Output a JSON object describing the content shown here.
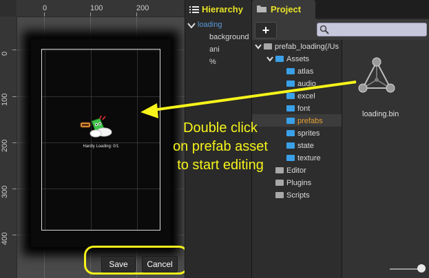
{
  "ruler": {
    "top_labels": [
      "0",
      "100",
      "200"
    ],
    "left_labels": [
      "0",
      "100",
      "200",
      "300",
      "400"
    ]
  },
  "scene": {
    "loading_text": "Hardly Loading: 0/1",
    "save_label": "Save",
    "cancel_label": "Cancel"
  },
  "hierarchy": {
    "title": "Hierarchy",
    "items": [
      {
        "label": "loading"
      },
      {
        "label": "background"
      },
      {
        "label": "ani"
      },
      {
        "label": "%"
      }
    ]
  },
  "project": {
    "title": "Project",
    "add_label": "+",
    "tree": [
      {
        "label": "prefab_loading(/Us"
      },
      {
        "label": "Assets"
      },
      {
        "label": "atlas"
      },
      {
        "label": "audio"
      },
      {
        "label": "excel"
      },
      {
        "label": "font"
      },
      {
        "label": "prefabs"
      },
      {
        "label": "sprites"
      },
      {
        "label": "state"
      },
      {
        "label": "texture"
      },
      {
        "label": "Editor"
      },
      {
        "label": "Plugins"
      },
      {
        "label": "Scripts"
      }
    ],
    "preview_file": "loading.bin"
  },
  "annotation": {
    "lines": [
      "Double click",
      "on prefab asset",
      "to start editing"
    ]
  },
  "colors": {
    "accent_yellow": "#f6f41a",
    "selected_blue": "#5a9ad8",
    "folder_gray": "#a8a8a8",
    "folder_blue": "#3aa0e8",
    "selected_orange": "#e6a030"
  }
}
